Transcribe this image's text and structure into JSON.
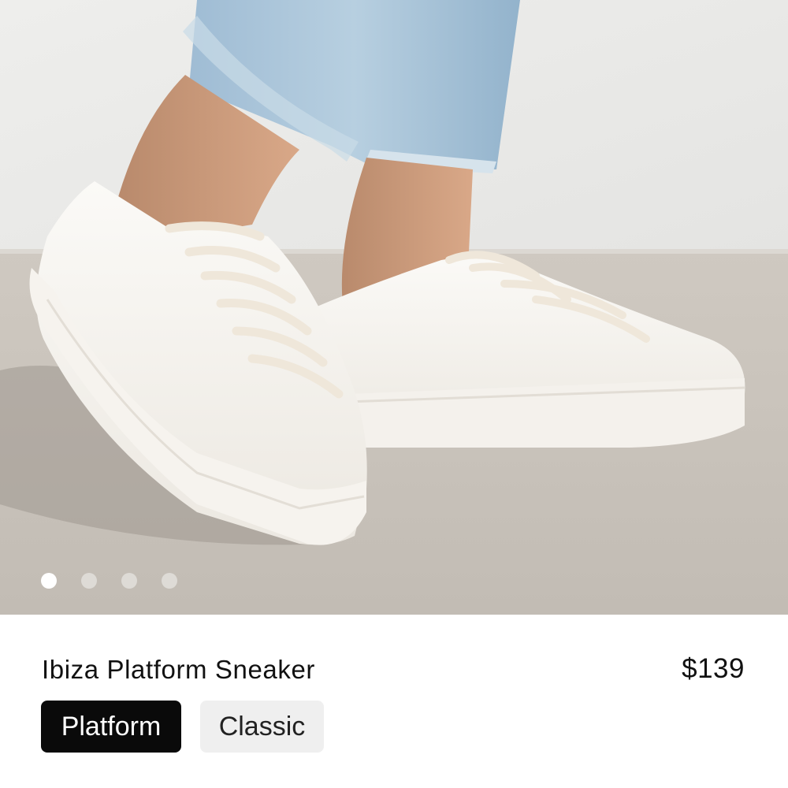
{
  "carousel": {
    "image_alt": "White leather platform sneakers worn with light-wash jeans",
    "slide_count": 4,
    "active_index": 0
  },
  "product": {
    "name": "Ibiza Platform Sneaker",
    "price": "$139"
  },
  "variants": [
    {
      "label": "Platform",
      "selected": true
    },
    {
      "label": "Classic",
      "selected": false
    }
  ],
  "colors": {
    "selected_bg": "#0a0a0a",
    "unselected_bg": "#efefef",
    "text": "#111111"
  }
}
